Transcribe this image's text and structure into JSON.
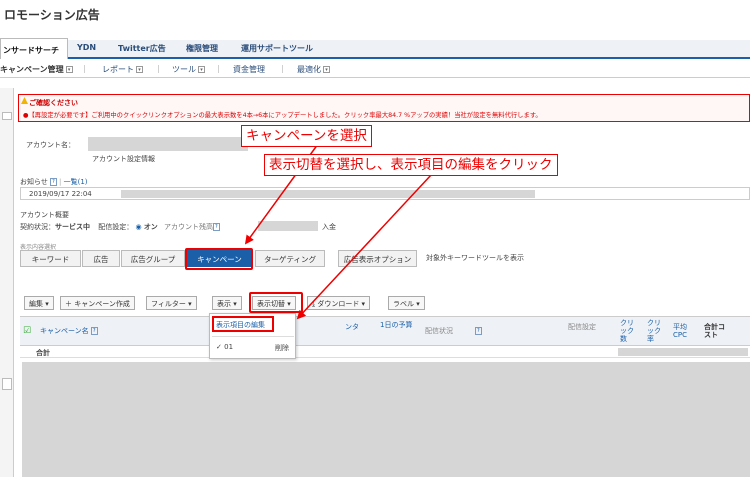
{
  "page_title": "ロモーション広告",
  "top_tabs": [
    "ンサードサーチ",
    "YDN",
    "Twitter広告",
    "権限管理",
    "運用サポートツール"
  ],
  "sub_nav": [
    "キャンペーン管理",
    "レポート",
    "ツール",
    "資金管理",
    "最適化"
  ],
  "alert": {
    "heading": "ご確認ください",
    "message": "●【再設定が必要です】ご利用中のクイックリンクオプションの最大表示数を4本→6本にアップデートしました。クリック率最大84.7 %アップの実績！当社が設定を無料代行します。"
  },
  "account": {
    "name_label": "アカウント名：",
    "settings_link": "アカウント設定情報"
  },
  "notice": {
    "label": "お知らせ",
    "list_link": "一覧(1)",
    "date": "2019/09/17 22:04"
  },
  "overview": {
    "title": "アカウント概要",
    "contract_label": "契約状況：",
    "contract_value": "サービス中",
    "delivery_label": "配信設定：",
    "delivery_value": "オン",
    "balance_label": "アカウント残高",
    "deposit_link": "入金"
  },
  "display_selection_label": "表示内容選択",
  "content_tabs": [
    "キーワード",
    "広告",
    "広告グループ",
    "キャンペーン",
    "ターゲティング",
    "広告表示オプション"
  ],
  "keyword_tool_link": "対象外キーワードツールを表示",
  "toolbar": {
    "edit": "編集 ▾",
    "create_campaign": "＋ キャンペーン作成",
    "filter": "フィルター ▾",
    "display": "表示 ▾",
    "switch_display": "表示切替 ▾",
    "download": "⤓ ダウンロード ▾",
    "label": "ラベル ▾"
  },
  "dropdown": {
    "edit_items": "表示項目の編集",
    "preset": "01",
    "delete": "削除"
  },
  "table": {
    "col_campaign": "キャンペーン名",
    "col_center": "ンタ",
    "col_daily_budget": "1日の予算",
    "col_status": "配信状況",
    "col_delivery_setting": "配信設定",
    "col_clicks": "クリック数",
    "col_ctr": "クリック率",
    "col_avg_cpc": "平均CPC",
    "col_total_cost": "合計コスト",
    "total_row": "合計"
  },
  "annotations": {
    "select_campaign": "キャンペーンを選択",
    "select_switch": "表示切替を選択し、表示項目の編集をクリック"
  },
  "colors": {
    "accent": "#1a5fa8",
    "annotation": "#e00000"
  }
}
